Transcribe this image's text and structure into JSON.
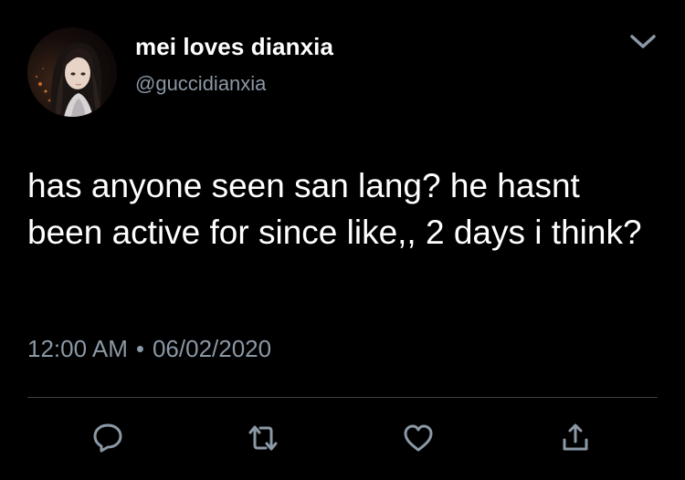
{
  "tweet": {
    "author": {
      "display_name": "mei loves dianxia",
      "handle": "@guccidianxia",
      "avatar_icon": "avatar-portrait"
    },
    "text": "has anyone seen san lang? he hasnt been active for since like,, 2 days i think?",
    "time": "12:00 AM",
    "separator": "•",
    "date": "06/02/2020"
  },
  "actions": [
    {
      "name": "reply",
      "icon": "reply-icon"
    },
    {
      "name": "retweet",
      "icon": "retweet-icon"
    },
    {
      "name": "like",
      "icon": "heart-icon"
    },
    {
      "name": "share",
      "icon": "share-icon"
    }
  ],
  "menu": {
    "icon": "chevron-down-icon"
  },
  "colors": {
    "background": "#000000",
    "primary_text": "#ffffff",
    "secondary_text": "#8b98a5",
    "divider": "#3a3d40"
  }
}
